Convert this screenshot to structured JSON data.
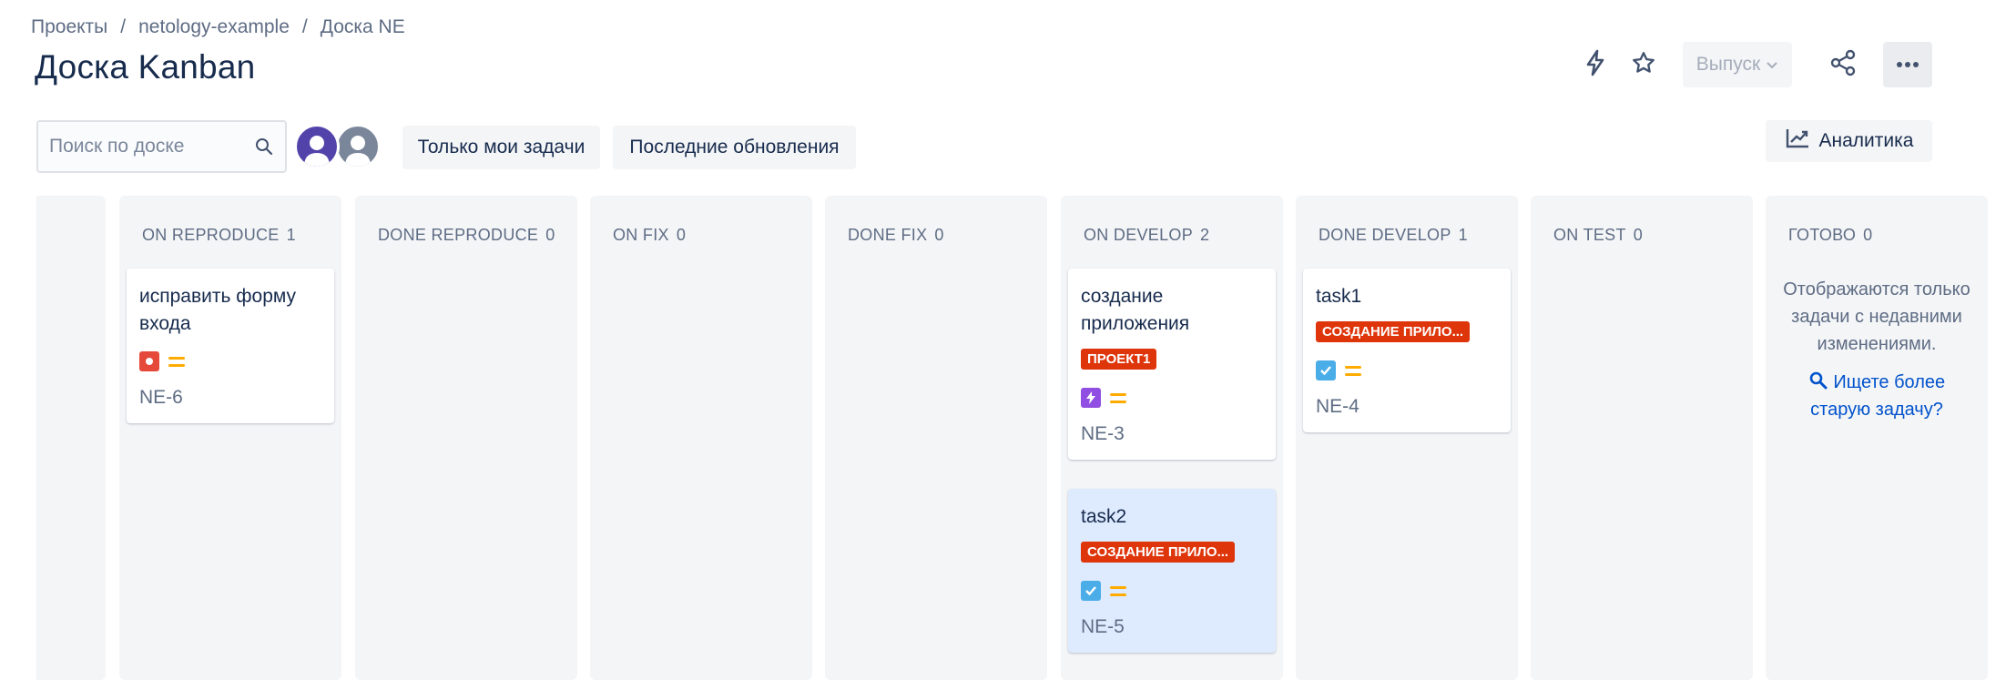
{
  "breadcrumb": [
    "Проекты",
    "netology-example",
    "Доска NE"
  ],
  "page_title": "Доска Kanban",
  "header": {
    "release_label": "Выпуск",
    "icons": [
      "lightning-icon",
      "star-icon",
      "share-icon",
      "more-icon"
    ]
  },
  "toolbar": {
    "search_placeholder": "Поиск по доске",
    "filter_mine": "Только мои задачи",
    "filter_recent": "Последние обновления",
    "analytics_label": "Аналитика"
  },
  "columns": [
    {
      "name": "ON REPRODUCE",
      "count": "1"
    },
    {
      "name": "DONE REPRODUCE",
      "count": "0"
    },
    {
      "name": "ON FIX",
      "count": "0"
    },
    {
      "name": "DONE FIX",
      "count": "0"
    },
    {
      "name": "ON DEVELOP",
      "count": "2"
    },
    {
      "name": "DONE DEVELOP",
      "count": "1"
    },
    {
      "name": "ON TEST",
      "count": "0"
    },
    {
      "name": "ГОТОВО",
      "count": "0"
    }
  ],
  "cards": {
    "ne6": {
      "title": "исправить форму входа",
      "key": "NE-6",
      "type": "bug",
      "priority": "medium"
    },
    "ne3": {
      "title": "создание приложения",
      "epic": "ПРОЕКТ1",
      "key": "NE-3",
      "type": "epic",
      "priority": "medium"
    },
    "ne5": {
      "title": "task2",
      "epic": "СОЗДАНИЕ ПРИЛО...",
      "key": "NE-5",
      "type": "task",
      "priority": "medium"
    },
    "ne4": {
      "title": "task1",
      "epic": "СОЗДАНИЕ ПРИЛО...",
      "key": "NE-4",
      "type": "task",
      "priority": "medium"
    }
  },
  "done_column": {
    "note": "Отображаются только задачи с недавними изменениями.",
    "older_link": "Ищете более старую задачу?"
  },
  "colors": {
    "accent": "#0052cc",
    "epic_tag": "#de350b",
    "bug": "#e5493a",
    "task": "#4bade8",
    "epic": "#904ee2",
    "priority_medium": "#ffab00",
    "column_bg": "#f4f5f7",
    "selected_card": "#deebff"
  }
}
